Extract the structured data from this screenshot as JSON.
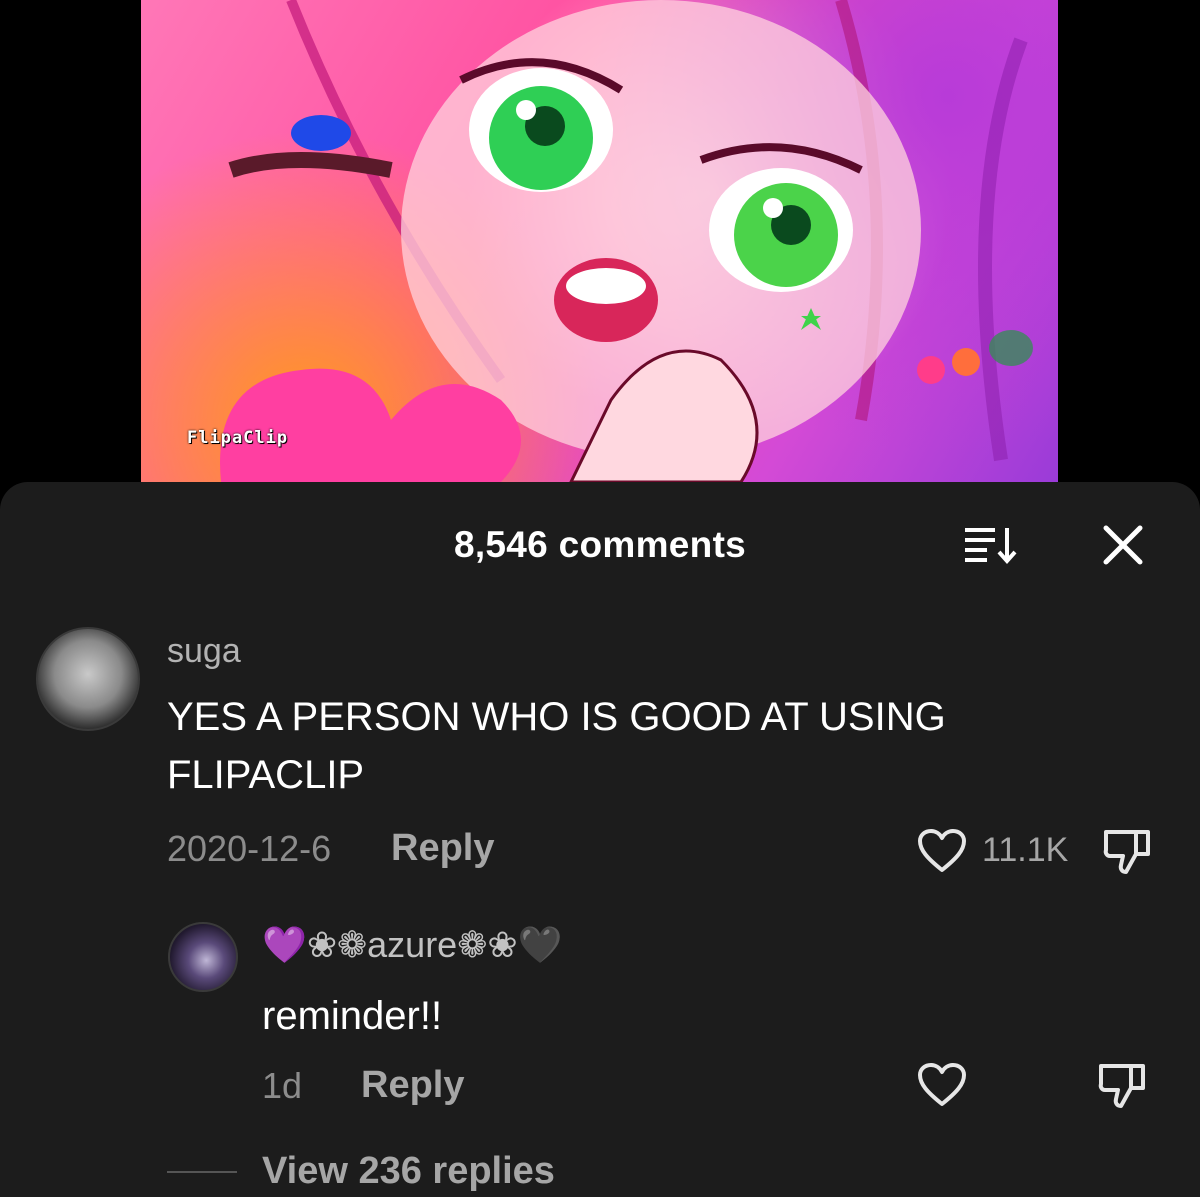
{
  "video": {
    "watermark": "FlipaClip"
  },
  "comments_sheet": {
    "title": "8,546 comments",
    "sort_icon": "sort-descending-icon",
    "close_icon": "close-icon",
    "comments": [
      {
        "username": "suga",
        "text": "YES A PERSON WHO IS GOOD AT USING FLIPACLIP",
        "date": "2020-12-6",
        "reply_label": "Reply",
        "like_count": "11.1K",
        "like_icon": "heart-outline-icon",
        "dislike_icon": "thumbs-down-icon",
        "avatar": "user-avatar"
      }
    ],
    "replies": [
      {
        "username": "💜❀❁azure❁❀🖤",
        "text": "reminder!!",
        "date": "1d",
        "reply_label": "Reply",
        "like_icon": "heart-outline-icon",
        "dislike_icon": "thumbs-down-icon",
        "avatar": "user-avatar"
      }
    ],
    "view_replies_label": "View 236 replies"
  },
  "colors": {
    "sheet_background": "#1c1c1c",
    "primary_text": "#ffffff",
    "secondary_text": "#a6a6a6"
  }
}
